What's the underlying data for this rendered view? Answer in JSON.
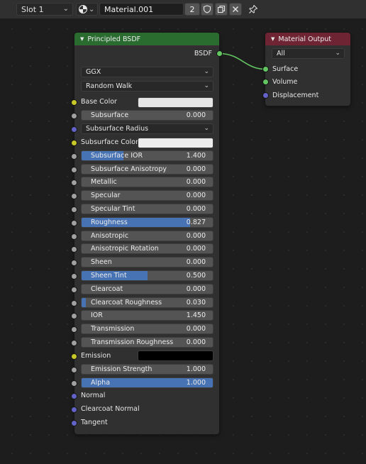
{
  "header": {
    "slot_label": "Slot 1",
    "material_name": "Material.001",
    "user_count": "2"
  },
  "principled": {
    "title": "Principled BSDF",
    "header_color": "#2a6b30",
    "output_label": "BSDF",
    "distribution": "GGX",
    "subsurface_method": "Random Walk",
    "base_color": {
      "label": "Base Color",
      "swatch": "#e6e6e6"
    },
    "subsurface": {
      "label": "Subsurface",
      "value": "0.000",
      "fill": 0
    },
    "subsurface_radius": {
      "label": "Subsurface Radius"
    },
    "subsurface_color": {
      "label": "Subsurface Color",
      "swatch": "#ececec"
    },
    "subsurface_ior": {
      "label": "Subsurface IOR",
      "value": "1.400",
      "fill": 0.32
    },
    "subsurface_anisotropy": {
      "label": "Subsurface Anisotropy",
      "value": "0.000",
      "fill": 0
    },
    "metallic": {
      "label": "Metallic",
      "value": "0.000",
      "fill": 0
    },
    "specular": {
      "label": "Specular",
      "value": "0.000",
      "fill": 0
    },
    "specular_tint": {
      "label": "Specular Tint",
      "value": "0.000",
      "fill": 0
    },
    "roughness": {
      "label": "Roughness",
      "value": "0.827",
      "fill": 0.827
    },
    "anisotropic": {
      "label": "Anisotropic",
      "value": "0.000",
      "fill": 0
    },
    "anisotropic_rotation": {
      "label": "Anisotropic Rotation",
      "value": "0.000",
      "fill": 0
    },
    "sheen": {
      "label": "Sheen",
      "value": "0.000",
      "fill": 0
    },
    "sheen_tint": {
      "label": "Sheen Tint",
      "value": "0.500",
      "fill": 0.5
    },
    "clearcoat": {
      "label": "Clearcoat",
      "value": "0.000",
      "fill": 0
    },
    "clearcoat_roughness": {
      "label": "Clearcoat Roughness",
      "value": "0.030",
      "fill": 0.03
    },
    "ior": {
      "label": "IOR",
      "value": "1.450",
      "fill": 0
    },
    "transmission": {
      "label": "Transmission",
      "value": "0.000",
      "fill": 0
    },
    "transmission_roughness": {
      "label": "Transmission Roughness",
      "value": "0.000",
      "fill": 0
    },
    "emission": {
      "label": "Emission",
      "swatch": "#000000"
    },
    "emission_strength": {
      "label": "Emission Strength",
      "value": "1.000",
      "fill": 0
    },
    "alpha": {
      "label": "Alpha",
      "value": "1.000",
      "fill": 1
    },
    "normal": {
      "label": "Normal"
    },
    "clearcoat_normal": {
      "label": "Clearcoat Normal"
    },
    "tangent": {
      "label": "Tangent"
    }
  },
  "material_output": {
    "title": "Material Output",
    "header_color": "#6e2432",
    "target": "All",
    "surface": "Surface",
    "volume": "Volume",
    "displacement": "Displacement"
  },
  "colors": {
    "socket_shader": "#62c562",
    "socket_color": "#c7c729",
    "socket_float": "#a1a1a1",
    "socket_vector": "#6363c7",
    "slider_fill": "#4772b3",
    "link": "#62c562"
  }
}
